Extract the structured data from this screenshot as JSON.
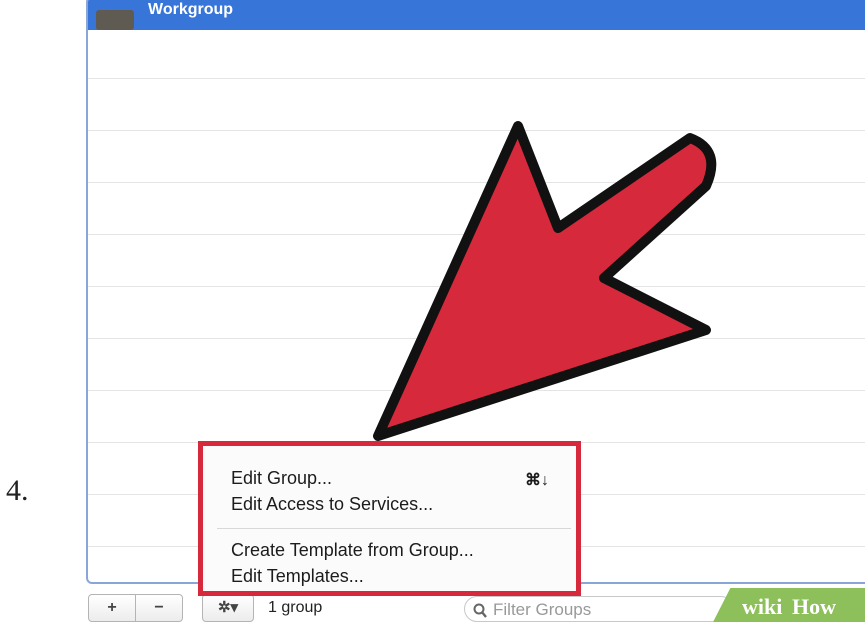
{
  "step_number": "4.",
  "group_list": {
    "group_name": "Workgroup"
  },
  "context_menu": {
    "items": [
      {
        "label": "Edit Group...",
        "shortcut": "⌘↓"
      },
      {
        "label": "Edit Access to Services..."
      },
      {
        "label": "Create Template from Group..."
      },
      {
        "label": "Edit Templates..."
      }
    ],
    "highlight_color": "#d6293c"
  },
  "bottom_bar": {
    "add_label": "+",
    "remove_label": "−",
    "gear_label": "✲▾",
    "group_count": "1 group",
    "filter_placeholder": "Filter Groups"
  },
  "watermark": {
    "part1": "wiki",
    "part2": "How"
  },
  "colors": {
    "selection": "#3775d8",
    "arrow": "#d6293c",
    "watermark": "#8dbf5a"
  }
}
